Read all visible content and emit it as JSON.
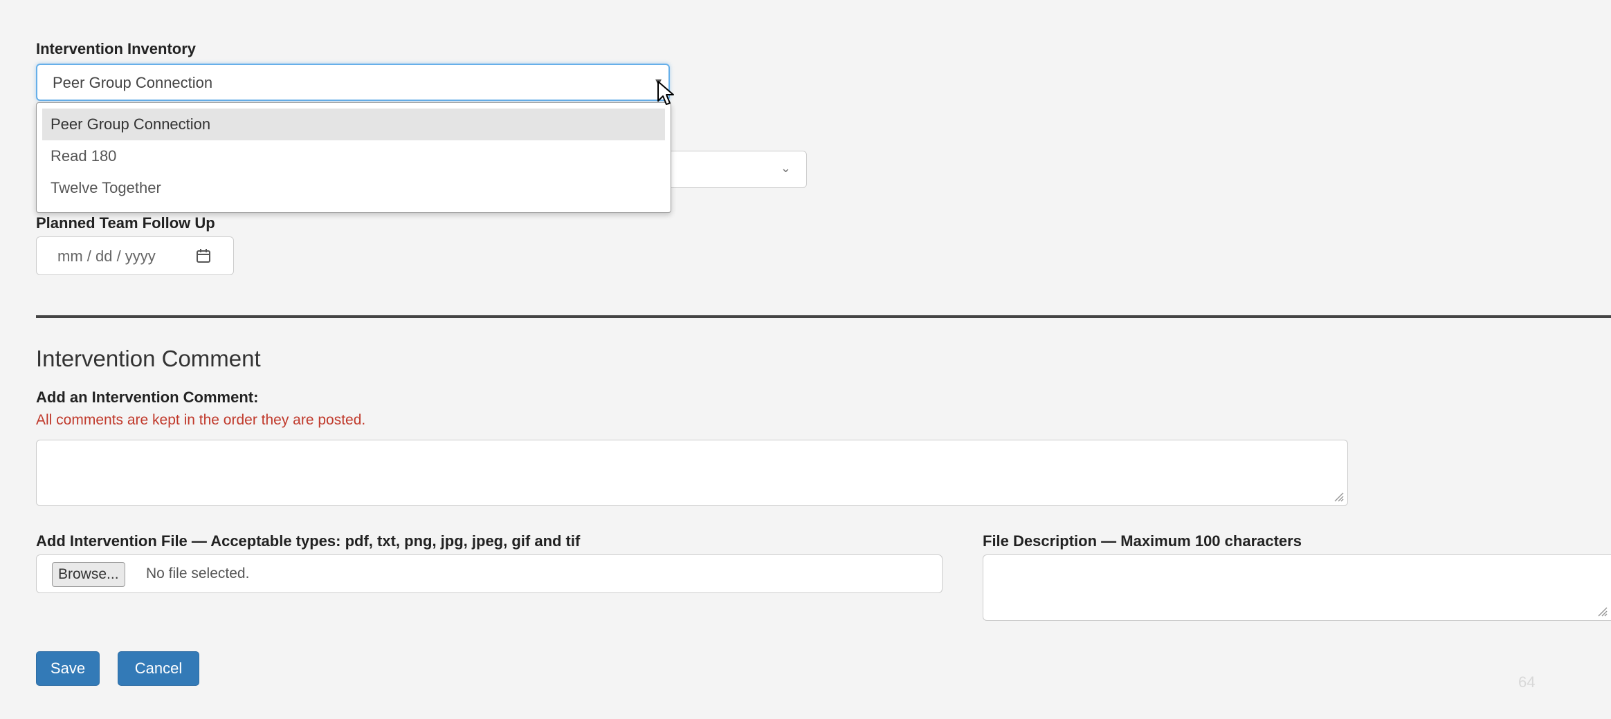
{
  "inventory": {
    "label": "Intervention Inventory",
    "selected": "Peer Group Connection",
    "options": [
      "Peer Group Connection",
      "Read 180",
      "Twelve Together"
    ]
  },
  "follow_up": {
    "label": "Planned Team Follow Up",
    "placeholder": "mm / dd / yyyy"
  },
  "comment_section": {
    "title": "Intervention Comment",
    "add_label": "Add an Intervention Comment:",
    "note": "All comments are kept in the order they are posted.",
    "note_color": "#c0392b"
  },
  "file": {
    "label": "Add Intervention File — Acceptable types: pdf, txt, png, jpg, jpeg, gif and tif",
    "browse_label": "Browse...",
    "status": "No file selected."
  },
  "file_description": {
    "label": "File Description — Maximum 100 characters"
  },
  "actions": {
    "save_label": "Save",
    "cancel_label": "Cancel",
    "primary_color": "#337ab7"
  },
  "page_number": "64"
}
